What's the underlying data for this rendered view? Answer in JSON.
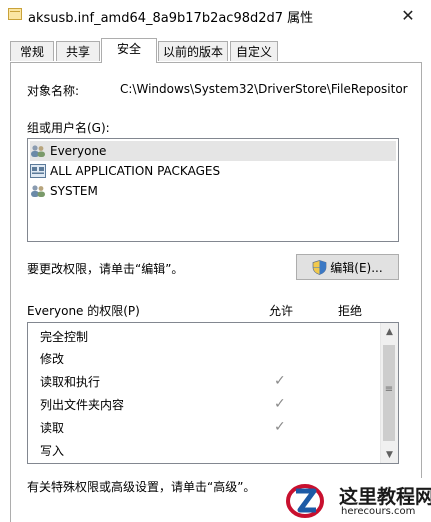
{
  "window": {
    "title": "aksusb.inf_amd64_8a9b17b2ac98d2d7 属性",
    "close_symbol": "✕"
  },
  "tabs": [
    {
      "label": "常规"
    },
    {
      "label": "共享"
    },
    {
      "label": "安全",
      "active": true
    },
    {
      "label": "以前的版本"
    },
    {
      "label": "自定义"
    }
  ],
  "object": {
    "label": "对象名称:",
    "value": "C:\\Windows\\System32\\DriverStore\\FileRepositor"
  },
  "users": {
    "label": "组或用户名(G):",
    "items": [
      {
        "name": "Everyone",
        "icon": "users-group-icon",
        "selected": true
      },
      {
        "name": "ALL APPLICATION PACKAGES",
        "icon": "app-packages-icon"
      },
      {
        "name": "SYSTEM",
        "icon": "users-group-icon"
      }
    ]
  },
  "edit": {
    "hint": "要更改权限，请单击“编辑”。",
    "button_label": "编辑(E)..."
  },
  "permissions": {
    "header": "Everyone 的权限(P)",
    "allow_label": "允许",
    "deny_label": "拒绝",
    "rows": [
      {
        "name": "完全控制",
        "allow": false,
        "deny": false
      },
      {
        "name": "修改",
        "allow": false,
        "deny": false
      },
      {
        "name": "读取和执行",
        "allow": true,
        "deny": false
      },
      {
        "name": "列出文件夹内容",
        "allow": true,
        "deny": false
      },
      {
        "name": "读取",
        "allow": true,
        "deny": false
      },
      {
        "name": "写入",
        "allow": false,
        "deny": false
      }
    ],
    "check_glyph": "✓"
  },
  "advanced": {
    "hint": "有关特殊权限或高级设置，请单击“高级”。"
  },
  "watermark": {
    "title": "这里教程网",
    "url": "herecours.com"
  }
}
